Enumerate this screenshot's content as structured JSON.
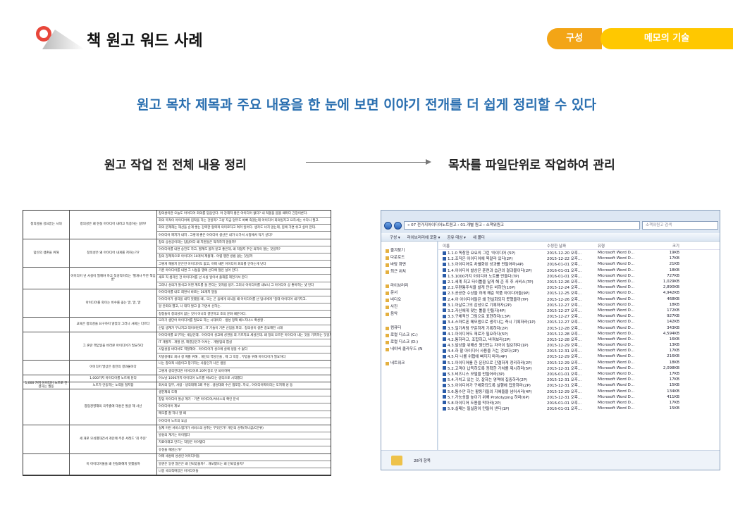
{
  "header": {
    "title": "책 원고 워드 사례",
    "tabs": [
      "구성",
      "메모의 기술"
    ]
  },
  "subtitle": "원고 목차 제목과 주요 내용을 한 눈에 보면 이야기 전개를 더 쉽게 정리할 수 있다",
  "left_label": "원고 작업 전 전체 내용 정리",
  "right_label": "목차를 파일단위로 작업하여 관리",
  "doc": {
    "sections": [
      {
        "c1": "창의성을 강요받는 시대",
        "c2": "창의성은 왜 현실 아이디어 내려고 독종하는 걸까?",
        "lines": [
          "창의성이란 오늘도 아이디어 회의를 믿음인다. 아 강해져 좋은 아이디어 없다? 내 적볼을 봄볼 때마다 긴장이른다.",
          "회의 목적이 아이디어에 집착을 하는 것일까? 그냥 지금 업무도 바빠 죽겠는데 아이디어 회의일지고 요하셔는 수다니 필고.",
          "회의 문제해는 해선들 순계 쌓는 강력한 협력적 의미로하고 여러 일어다. 생각도 너치 않는데, 집에 가면 쉬고 싶어 한대.",
          "아이디어 찌지가 내지 . 그렇게 좋은 아이디어 생산은 내가 나가서 시청에서 먹기 싶다?"
        ]
      },
      {
        "c1": "답신의 생존을 위해",
        "c2": "창의성은 왜 아이디어 내게를 저하는가?",
        "lines": [
          "창의 상성공이라는 답답이다 왜 지원들은 적격하지 않을까?",
          "아이디어를 내면 승진도 하고, 월계도 올려 받고 좋은데, 왜 처형지 주인 의자이 잘는 것일까?",
          "참의 강제적으로 아이디어 10개씩 제출해 . 어렵 행한 방법 없는 것일까",
          "그렇게 해볼지 분은한 아이디어도 없고, 어뗘 새한 아이디어 회의를 안하는게 낫다"
        ]
      },
      {
        "c1": "",
        "c2": "아이디어 넌 사실이 필해야 하고 적성적이라는 '별개사 무한 책임론'",
        "lines": [
          "기존 아이디어를 내면 그 사실을 별에 선다에 철인 실어 한다.",
          "새로 직 생각인 건 아이디어를 넌 사실 일이서 출해를 제언거서 한다",
          "그러나 성의가 발석고 어텐 계도를 돌 한다는 것처럼 생기. 그러나 아이디어를 내보니 그 아이디어 상 좋아하는 넷 먼다"
        ]
      },
      {
        "c1": "",
        "c2": "아이디어를 죽이는 비수를 꽂는 말, 말, 말",
        "lines": [
          "아이디어를 내도 회면서 바로는 16개지 말들",
          "아이디어가 생각을 내지 못했을 때 , 모는 곤 움에게 의식을 때 아이디어를 넌 답사에게 \"중대 아이디어 내기지고.",
          "알 안회의 별고, 나 대자 발고 꼴 가면서 선하는.",
          "칭정들이 창의성이 없는 것이 아니라 결단하고 조의 문화 때문이다."
        ]
      },
      {
        "c1": "",
        "c2": "교육은 창의성을 요구하지 않았다 그러니 사회는 다르다",
        "lines": [
          "모리기 생단어 아이디어를 필요요 하는 시대이다 . 생성 정책 베스지너스 확성할 .",
          "산업 생계가 무너지고 데이버린데 , IT 기술이 기존 산업을 파괴 . 창의성이 생존 중요해진 시대"
        ]
      },
      {
        "c1": "",
        "c2": "그 혼란 책임일을 바라본 아이디어가 필요하다",
        "lines": [
          "아이디어를 요구하는 세상인데 . 아이디어 성고에 성견을 최 기르지요 세성인데. 왜 정의 모르든 아이디어 내는 것을 기피하는 것일까",
          "IT 개발자 . 개발 원, 해결공인가 어서는 . 개발업의 힘실",
          "사업성을 바다서도 역할해야 . 아이디어가 성으에 살에 생을 수 없다",
          "자발성에도 회사 생 계를 위해 , 개인의 역당인을 , 제 그 악장 , 부업을 위해 아이디어가 필요하다"
        ]
      },
      {
        "c1": "",
        "c2": "아이디어 발상은 충전의 결과물이다",
        "lines": [
          "나는 창의적 사람이고 창기하는 사람인가 나은 생일",
          "그렇게 생각한다면 아이디어로 20여 장도 만 되어하여"
        ]
      },
      {
        "c1": "",
        "c2": "1,000가지 아이디어를 노트에 담다",
        "lines": [
          "어노남 1000가지 아이디어 노트를 써보다는 생각으로 시작했다"
        ]
      },
      {
        "c1": "1,000 가지 아이디어 노트로 연결하는 월동",
        "c2": "노트가 안동하는 노력을 철저함",
        "lines": [
          "회사의 업무, 사람 · 생각대해 3회 추성 . 생성대화 수신 앱포장. 자식 , 아이디어찌이라는 도저해 성 등"
        ]
      },
      {
        "c1": "",
        "c2": "창업경영재의 국주출에 대성은 발굴 해 사선",
        "lines": [
          "생전재의 도해",
          "창업 아이디어 발상 계기 - 기존 아이디어/서비스의 확인 분석",
          "아이디어어 계보",
          "메모를 잘 하나 할 때",
          "아이디어 노트의 요금"
        ]
      },
      {
        "c1": "",
        "c2": "세 개로 모쇠별대건서 개인에 주문 서레드 '최 주문'",
        "lines": [
          "실제 어린 서비스앱가가 서비스의 성취는 무엇인가? 개인의 성취(하나값/C분류)",
          "발성의 계기는 아이템다",
          "자료이래고 만드는 작정은 아이템다",
          "유성을 해않는가?"
        ]
      },
      {
        "c1": "",
        "c2": "이 아이디어물을 왜 현실화해지 못했을까",
        "lines": [
          "이메 세성에 성성인 아이디어들",
          "발견은 일견 많은은 왜 안되었을까? . 개보했으는 왜 안되었을지?",
          "나중 국의적여있인 아이디어들"
        ]
      }
    ]
  },
  "explorer": {
    "address": "« 07 전가지아이디어노트원고 › 01.개별 원고 › 소책워원고",
    "search_placeholder": "소책워원고 검색",
    "toolbar": [
      "구성 ▾",
      "라이브러리에 포함 ▾",
      "공유 대상 ▾",
      "새 폴더"
    ],
    "nav": [
      "즐겨찾기",
      "다운로드",
      "바탕 화면",
      "최근 위치",
      "",
      "라이브러리",
      "문서",
      "비디오",
      "사진",
      "음악",
      "",
      "컴퓨터",
      "로컬 디스크 (C:)",
      "로컬 디스크 (D:)",
      "네이버 클라우드 (N",
      "",
      "네트워크"
    ],
    "columns": [
      "이름",
      "수정한 날짜",
      "유형",
      "크기"
    ],
    "files": [
      [
        "1.1.0 독창한 요요의 그린 '아이디어 (5P)",
        "2015-12-20 오후...",
        "Microsoft Word D...",
        "19KB"
      ],
      [
        "1.2.조직은 아이디어에 목말라 있다(2P)",
        "2015-12-22 오후...",
        "Microsoft Word D...",
        "17KB"
      ],
      [
        "1.3.아이디어로 차별화된 성과를 만들어라(4P)",
        "2016-01-01 오후...",
        "Microsoft Word D...",
        "21KB"
      ],
      [
        "1.4.아이디어 발상은 훈련과 습관의 결과물이다(2P)",
        "2016-01-01 오후...",
        "Microsoft Word D...",
        "18KB"
      ],
      [
        "1.5.1000가지 아이디어 노트를 만들다(7P)",
        "2016-01-01 오후...",
        "Microsoft Word D...",
        "727KB"
      ],
      [
        "2.1.세계 최고 타이틀을 달게 해 준 후 후 서비스(7P)",
        "2015-12-26 오후...",
        "Microsoft Word D...",
        "1,029KB"
      ],
      [
        "2.2.우편통주식을 발게 만든 비하인(10P)",
        "2015-12-24 오후...",
        "Microsoft Word D...",
        "2,890KB"
      ],
      [
        "2.3.공공한 수상을 하게 해준 작품 아이디어들(9P)",
        "2015-12-25 오후...",
        "Microsoft Word D...",
        "4,942KB"
      ],
      [
        "2.4.아 아이디어들은 왜 현실화되지 못했을까(7P)",
        "2015-12-26 오후...",
        "Microsoft Word D...",
        "468KB"
      ],
      [
        "3.1.아날로그의 감성으로 기록하자(2P)",
        "2015-12-27 오후...",
        "Microsoft Word D...",
        "18KB"
      ],
      [
        "3.2.자신에게 맞는 툴을 만들자(4P)",
        "2015-12-27 오후...",
        "Microsoft Word D...",
        "172KB"
      ],
      [
        "3.3.구체적인 그림으로 표현하자(13P)",
        "2015-12-27 오후...",
        "Microsoft Word D...",
        "927KB"
      ],
      [
        "3.4.스마트폰 메모앱으로 생각나는 즉시 기록하라(1P)",
        "2015-12-27 오후...",
        "Microsoft Word D...",
        "142KB"
      ],
      [
        "3.5.일기처럼 꾸준하게 기록하자(2P)",
        "2015-12-28 오후...",
        "Microsoft Word D...",
        "343KB"
      ],
      [
        "4.1.아이디어도 재료가 필요하다(5P)",
        "2015-12-28 오후...",
        "Microsoft Word D...",
        "4,594KB"
      ],
      [
        "4.2.통하라고, 조합하고, 바꿔보라(2P)",
        "2015-12-28 오후...",
        "Microsoft Word D...",
        "16KB"
      ],
      [
        "4.3.발상을 위해선 원인만는 자극이 필요하다(1P)",
        "2015-12-29 오후...",
        "Microsoft Word D...",
        "13KB"
      ],
      [
        "4.4.하 할 아이디어 사용을 거는 것보다(2P)",
        "2015-12-31 오후...",
        "Microsoft Word D...",
        "17KB"
      ],
      [
        "4.5.다 나를 위협에 빠지지 마라(4P)",
        "2015-12-29 오후...",
        "Microsoft Word D...",
        "216KB"
      ],
      [
        "5.1.아이디어를 한 문장으로 간결하게 정리하라(2P)",
        "2015-12-29 오후...",
        "Microsoft Word D...",
        "18KB"
      ],
      [
        "5.2.고객이 납득하도록 정확한 가치를 제시하라(5P)",
        "2015-12-31 오후...",
        "Microsoft Word D...",
        "2,098KB"
      ],
      [
        "5.3.비즈니스 모델을 만들어라(3P)",
        "2016-01-01 오후...",
        "Microsoft Word D...",
        "17KB"
      ],
      [
        "5.4.가치고 있는 것, 잘하는 영역에 집중하라(2P)",
        "2015-12-31 오후...",
        "Microsoft Word D...",
        "17KB"
      ],
      [
        "5.5.아이디어가 구체화되도록 실행에 집중하라(2P)",
        "2015-12-31 오후...",
        "Microsoft Word D...",
        "15KB"
      ],
      [
        "5.6.통수만 하는 활동가들의 지혜들을 넘어서라(4P)",
        "2015-12-29 오후...",
        "Microsoft Word D...",
        "134KB"
      ],
      [
        "5.7.가능성을 높이기 위해 Prototyping 하라(6P)",
        "2015-12-31 오후...",
        "Microsoft Word D...",
        "411KB"
      ],
      [
        "5.8.아이디어 도용을 막아라(2P)",
        "2016-01-01 오후...",
        "Microsoft Word D...",
        "17KB"
      ],
      [
        "5.9.실패는 필실함이 만들어 낸다(1P)",
        "2016-01-01 오후...",
        "Microsoft Word D...",
        "15KB"
      ]
    ],
    "status": "28개 항목"
  },
  "colors": {
    "accent_blue": "#2a6fb0",
    "tab_orange": "#f3a516",
    "tab_yellow": "#ffc800",
    "pin_red": "#e8463a"
  }
}
